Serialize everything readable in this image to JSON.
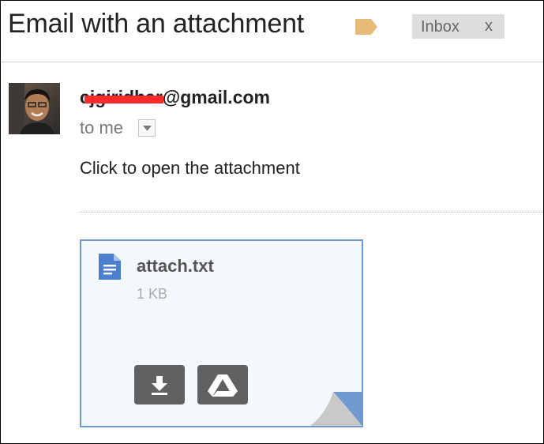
{
  "email": {
    "subject": "Email with an attachment",
    "label_color": "#e8bb78",
    "inbox_chip": {
      "label": "Inbox",
      "remove_label": "x"
    },
    "sender": {
      "email": "cjgiridhar@gmail.com",
      "avatar_icon": "person-photo-avatar"
    },
    "recipient_line": "to me",
    "details_icon": "chevron-down-icon",
    "body": "Click to open the attachment",
    "attachment": {
      "name": "attach.txt",
      "size": "1 KB",
      "file_icon": "text-document-icon",
      "accent_color": "#6f99cf",
      "actions": [
        {
          "name": "download",
          "icon": "download-icon"
        },
        {
          "name": "save-to-drive",
          "icon": "google-drive-icon"
        }
      ]
    }
  }
}
